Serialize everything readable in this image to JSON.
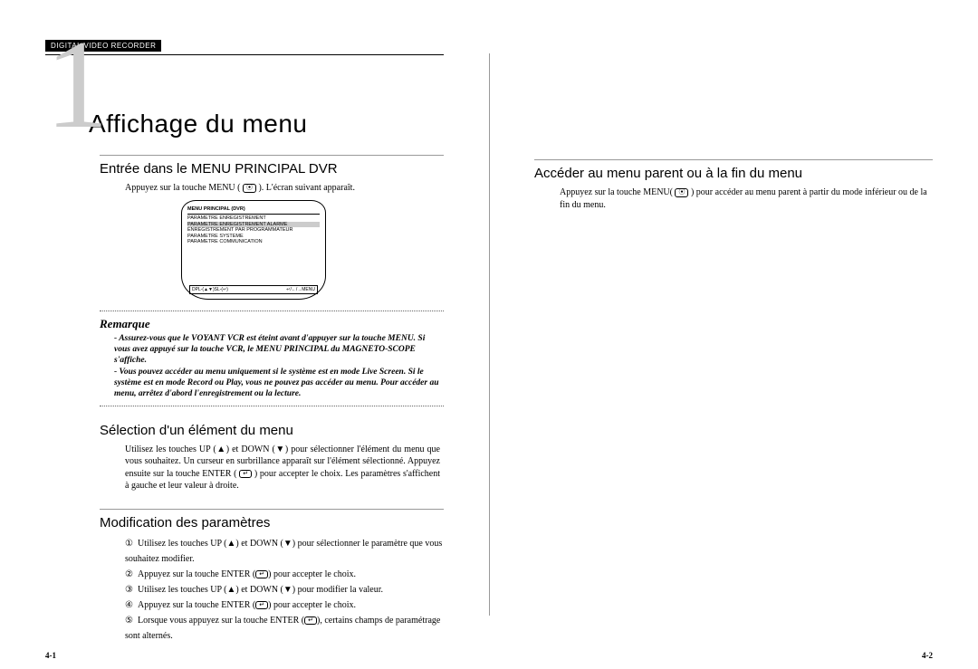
{
  "header_tag": "DIGITAL VIDEO RECORDER",
  "chapter_number": "1",
  "main_title": "Affichage du menu",
  "left": {
    "section1": {
      "title": "Entrée dans le MENU PRINCIPAL DVR",
      "intro_pre": "Appuyez sur la touche MENU (",
      "intro_icon": "⦿",
      "intro_post": "). L'écran suivant apparaît."
    },
    "tv": {
      "title": "MENU PRINCIPAL (DVR)",
      "items": [
        "PARAMETRE ENREGISTREMENT",
        "PARAMETRE ENREGISTREMENT ALARME",
        "ENREGISTREMENT PAR PROGRAMMATEUR",
        "PARAMETRE SYSTEME",
        "PARAMETRE COMMUNICATION"
      ],
      "highlight_index": 1,
      "footer_left": "DPL-(▲▼)SL-(↵)",
      "footer_right": "↵/←/→MENU"
    },
    "remarque": {
      "title": "Remarque",
      "bullets": [
        "Assurez-vous que le VOYANT VCR est éteint avant d'appuyer sur la touche MENU. Si vous avez appuyé sur la touche VCR, le MENU PRINCIPAL du MAGNETO-SCOPE s'affiche.",
        "Vous pouvez accéder au menu uniquement si le système est en mode Live Screen. Si le système est en mode Record ou Play, vous ne pouvez pas accéder au menu. Pour accéder au menu, arrêtez d'abord l'enregistrement ou la lecture."
      ]
    },
    "section2": {
      "title": "Sélection d'un élément du menu",
      "body_pre": "Utilisez les touches UP (▲) et DOWN (▼) pour sélectionner l'élément du menu que vous souhaitez. Un curseur en surbrillance apparaît sur l'élément sélectionné. Appuyez ensuite sur la touche ENTER (",
      "body_icon": "↵",
      "body_post": ") pour accepter le choix. Les paramètres s'affichent à gauche et leur valeur à droite."
    },
    "section3": {
      "title": "Modification des paramètres",
      "steps": [
        {
          "n": "①",
          "pre": "Utilisez les touches UP (▲) et DOWN (▼) pour sélectionner le paramètre que vous souhaitez modifier.",
          "icon": "",
          "post": ""
        },
        {
          "n": "②",
          "pre": "Appuyez sur la touche ENTER (",
          "icon": "↵",
          "post": ") pour accepter le choix."
        },
        {
          "n": "③",
          "pre": "Utilisez les touches UP (▲) et DOWN (▼) pour modifier la valeur.",
          "icon": "",
          "post": ""
        },
        {
          "n": "④",
          "pre": "Appuyez sur la touche ENTER (",
          "icon": "↵",
          "post": ") pour accepter le choix."
        },
        {
          "n": "⑤",
          "pre": "Lorsque vous appuyez sur la touche ENTER (",
          "icon": "↵",
          "post": "), certains champs de paramétrage sont alternés."
        }
      ]
    },
    "page_num": "4-1"
  },
  "right": {
    "section1": {
      "title": "Accéder au menu parent ou à la fin du menu",
      "body_pre": "Appuyez sur la touche MENU(",
      "body_icon": "⦿",
      "body_post": ") pour accéder au menu parent à partir du mode inférieur ou de la fin du menu."
    },
    "page_num": "4-2"
  }
}
